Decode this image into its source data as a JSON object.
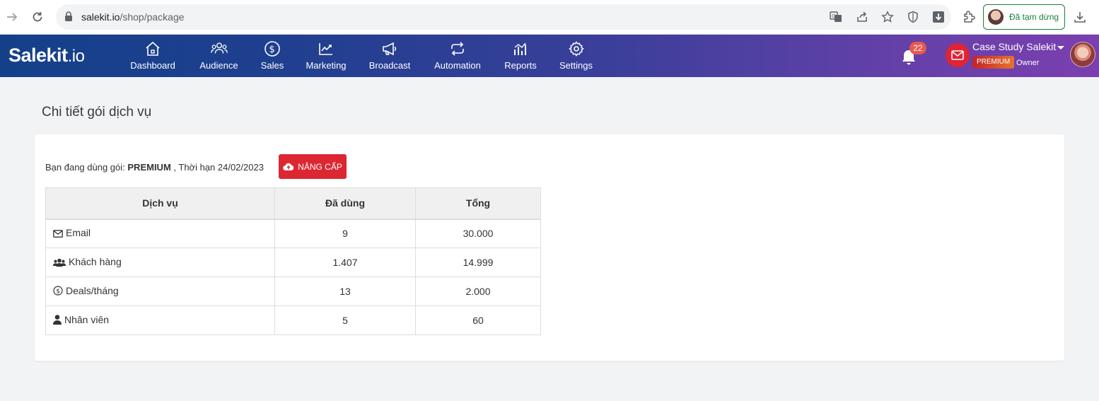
{
  "browser": {
    "url_host": "salekit.io",
    "url_path": "/shop/package",
    "profile_status": "Đã tạm dừng"
  },
  "header": {
    "logo_main": "Salekit",
    "logo_suffix": ".io",
    "nav": [
      {
        "label": "Dashboard",
        "icon": "home-icon"
      },
      {
        "label": "Audience",
        "icon": "users-icon"
      },
      {
        "label": "Sales",
        "icon": "dollar-circle-icon"
      },
      {
        "label": "Marketing",
        "icon": "chart-line-icon"
      },
      {
        "label": "Broadcast",
        "icon": "megaphone-icon"
      },
      {
        "label": "Automation",
        "icon": "repeat-icon"
      },
      {
        "label": "Reports",
        "icon": "bar-chart-icon"
      },
      {
        "label": "Settings",
        "icon": "gear-icon"
      }
    ],
    "notification_count": "22",
    "account_name": "Case Study Salekit",
    "plan_badge": "PREMIUM",
    "role": "Owner"
  },
  "main": {
    "title": "Chi tiết gói dịch vụ",
    "plan_prefix": "Bạn đang dùng gói: ",
    "plan_name": "PREMIUM",
    "plan_suffix": " , Thời hạn 24/02/2023",
    "upgrade_label": "NÂNG CẤP",
    "table": {
      "headers": [
        "Dịch vụ",
        "Đã dùng",
        "Tổng"
      ],
      "rows": [
        {
          "service": "Email",
          "icon": "envelope-icon",
          "used": "9",
          "total": "30.000"
        },
        {
          "service": "Khách hàng",
          "icon": "users-icon",
          "used": "1.407",
          "total": "14.999"
        },
        {
          "service": "Deals/tháng",
          "icon": "dollar-circle-icon",
          "used": "13",
          "total": "2.000"
        },
        {
          "service": "Nhân viên",
          "icon": "user-icon",
          "used": "5",
          "total": "60"
        }
      ]
    }
  },
  "colors": {
    "header_start": "#14408a",
    "header_end": "#7b3fb0",
    "upgrade_button": "#dc2733",
    "badge": "#e8584b"
  }
}
